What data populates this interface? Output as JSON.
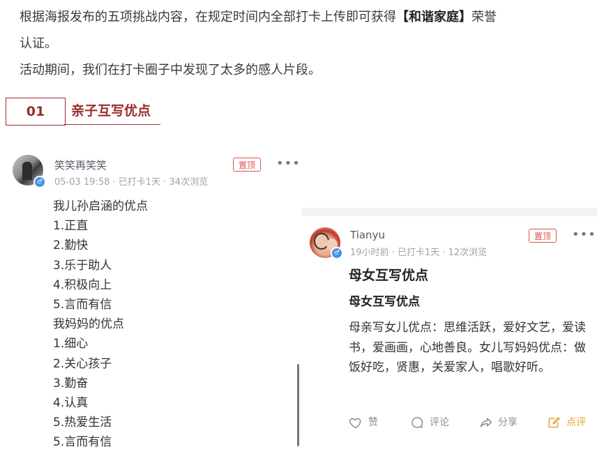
{
  "intro": {
    "line1_pre": "根据海报发布的五项挑战内容，在规定时间内全部打卡上传即可获得",
    "line1_bold": "【和谐家庭】",
    "line1_post": "荣誉",
    "line2": "认证。",
    "line3": "活动期间，我们在打卡圈子中发现了太多的感人片段。"
  },
  "section": {
    "number": "01",
    "title": "亲子互写优点",
    "accent": "#9b2c2c"
  },
  "post_left": {
    "username": "笑笑再笑笑",
    "meta": "05-03 19:58 · 已打卡1天 · 34次浏览",
    "pin_label": "置顶",
    "more_label": "•••",
    "lines": [
      "我儿孙启涵的优点",
      "1.正直",
      "2.勤快",
      "3.乐于助人",
      "4.积极向上",
      "5.言而有信",
      "我妈妈的优点",
      "1.细心",
      "2.关心孩子",
      "3.勤奋",
      "4.认真",
      "5.热爱生活",
      "5.言而有信"
    ]
  },
  "post_right": {
    "username": "Tianyu",
    "meta": "19小时前 · 已打卡1天 · 12次浏览",
    "pin_label": "置顶",
    "more_label": "•••",
    "title": "母女互写优点",
    "subtitle": "母女互写优点",
    "body": "母亲写女儿优点：思维活跃，爱好文艺，爱读书，爱画画，心地善良。女儿写妈妈优点：做饭好吃，贤惠，关爱家人，唱歌好听。",
    "actions": {
      "like": "赞",
      "comment": "评论",
      "share": "分享",
      "checkin": "点评"
    }
  },
  "colors": {
    "pin": "#d9534f",
    "gender_badge": "#4a90e2",
    "checkin": "#e0a531"
  },
  "icons": {
    "gender": "male-icon",
    "like": "heart-icon",
    "comment": "comment-bubble-icon",
    "share": "share-arrow-icon",
    "checkin": "edit-note-icon"
  }
}
